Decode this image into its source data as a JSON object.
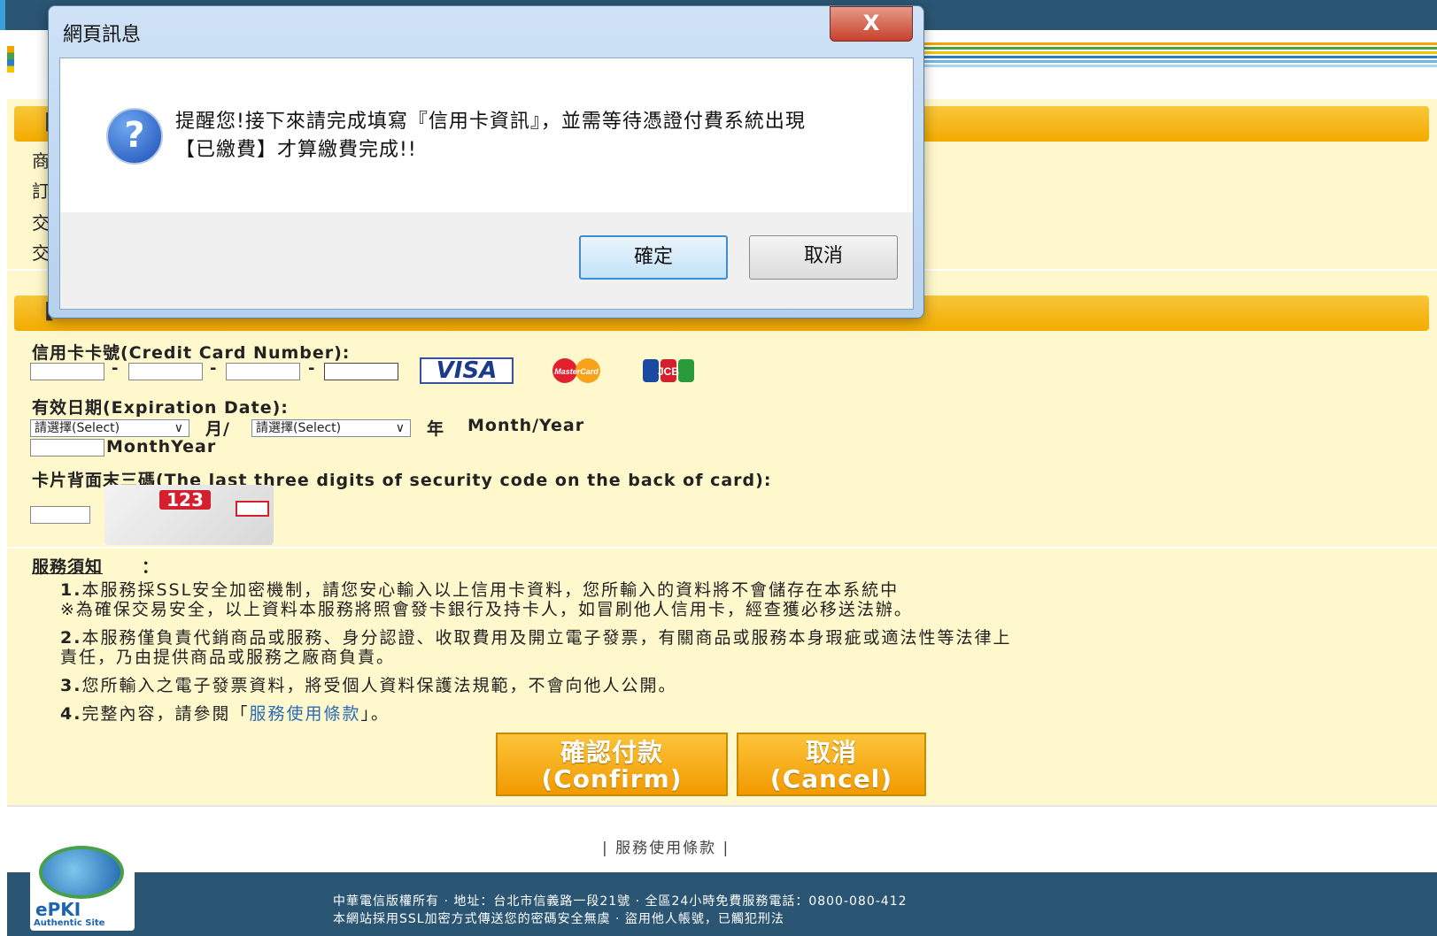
{
  "dialog": {
    "title": "網頁訊息",
    "close": "X",
    "message_line1": "提醒您!接下來請完成填寫『信用卡資訊』，並需等待憑證付費系統出現",
    "message_line2": "【已繳費】才算繳費完成!!",
    "ok": "確定",
    "cancel": "取消"
  },
  "order_info": {
    "bracket": "【",
    "rows": [
      "商",
      "訂",
      "交",
      "交"
    ]
  },
  "payment_section": {
    "bracket": "【"
  },
  "card": {
    "number_label": "信用卡卡號(Credit Card Number):",
    "dash": "-",
    "logos": [
      "VISA",
      "MasterCard",
      "JCB"
    ],
    "expiry_label": "有效日期(Expiration Date):",
    "month_select": "請選擇(Select)",
    "month_suffix": "月/",
    "year_select": "請選擇(Select)",
    "year_suffix": "年",
    "month_year_hint": "Month/Year",
    "month_year_label": "MonthYear",
    "cvv_label": "卡片背面末三碼(The last three digits of security code on the back of card):",
    "cvv_sample": "123"
  },
  "notice": {
    "title": "服務須知",
    "colon": "：",
    "item1_num": "1.",
    "item1_line1": "本服務採SSL安全加密機制，請您安心輸入以上信用卡資料，您所輸入的資料將不會儲存在本系統中",
    "item1_line2": "※為確保交易安全，以上資料本服務將照會發卡銀行及持卡人，如冒刷他人信用卡，經查獲必移送法辦。",
    "item2_num": "2.",
    "item2_line1": "本服務僅負責代銷商品或服務、身分認證、收取費用及開立電子發票，有關商品或服務本身瑕疵或適法性等法律上",
    "item2_line2": "責任，乃由提供商品或服務之廠商負責。",
    "item3_num": "3.",
    "item3": "您所輸入之電子發票資料，將受個人資料保護法規範，不會向他人公開。",
    "item4_num": "4.",
    "item4_prefix": "完整內容，請參閱「",
    "item4_link": "服務使用條款",
    "item4_suffix": "」。"
  },
  "buttons": {
    "confirm_line1": "確認付款",
    "confirm_line2": "(Confirm)",
    "cancel_line1": "取消",
    "cancel_line2": "(Cancel)"
  },
  "terms_link": "| 服務使用條款 |",
  "footer": {
    "line1": "中華電信版權所有 · 地址：台北市信義路一段21號 · 全區24小時免費服務電話：0800-080-412",
    "line2": "本網站採用SSL加密方式傳送您的密碼安全無虞 · 盜用他人帳號，已觸犯刑法",
    "epki": "ePKI",
    "epki_sub": "Authentic Site"
  },
  "colors": {
    "header": "#2a5573",
    "panel": "#fff8cc",
    "section_bar": "#f3ab00",
    "button": "#f29a00"
  }
}
